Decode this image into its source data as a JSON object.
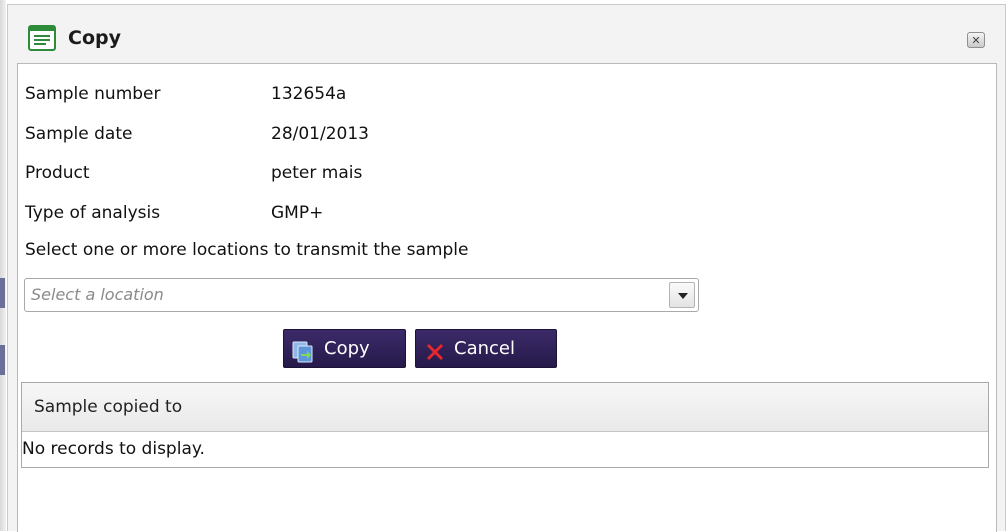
{
  "window": {
    "title": "Copy",
    "close_symbol": "✕"
  },
  "fields": [
    {
      "label": "Sample number",
      "value": "132654a"
    },
    {
      "label": "Sample date",
      "value": "28/01/2013"
    },
    {
      "label": "Product",
      "value": "peter mais"
    },
    {
      "label": "Type of analysis",
      "value": "GMP+"
    }
  ],
  "location": {
    "caption": "Select one or more locations to transmit the sample",
    "placeholder": "Select a location",
    "icon": "chevron-down-icon"
  },
  "buttons": {
    "copy_label": "Copy",
    "copy_icon": "copy-icon",
    "cancel_label": "Cancel",
    "cancel_icon": "x-icon"
  },
  "grid": {
    "columns": [
      "Sample copied to"
    ],
    "empty_text": "No records to display."
  },
  "colors": {
    "button_bg": "#2f2159",
    "cancel_icon": "#e8262c",
    "title_icon": "#2e8b3a"
  }
}
